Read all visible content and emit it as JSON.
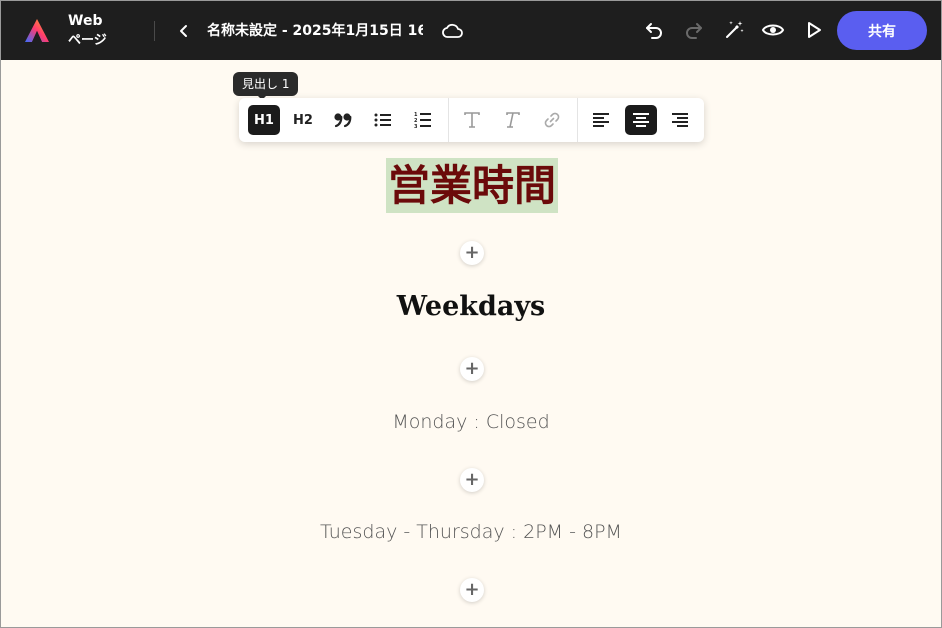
{
  "header": {
    "app_title": "Web",
    "app_subtitle": "ページ",
    "doc_title": "名称未設定 - 2025年1月15日 16.…",
    "share_label": "共有"
  },
  "tooltip": {
    "text": "見出し 1"
  },
  "format_toolbar": {
    "h1_label": "H1",
    "h2_label": "H2",
    "buttons": [
      "H1",
      "H2",
      "quote",
      "bullet-list",
      "numbered-list",
      "text-style",
      "italic-text",
      "link",
      "align-left",
      "align-center",
      "align-right"
    ],
    "active": [
      "H1",
      "align-center"
    ]
  },
  "content": {
    "heading": "営業時間",
    "subheading": "Weekdays",
    "line1": "Monday : Closed",
    "line2": "Tuesday - Thursday : 2PM - 8PM"
  },
  "colors": {
    "topbar": "#1e1e1e",
    "canvas": "#fffaf2",
    "share_button": "#5a5ef0",
    "heading_text": "#6b0a0a",
    "heading_highlight": "#cfe3c4"
  }
}
